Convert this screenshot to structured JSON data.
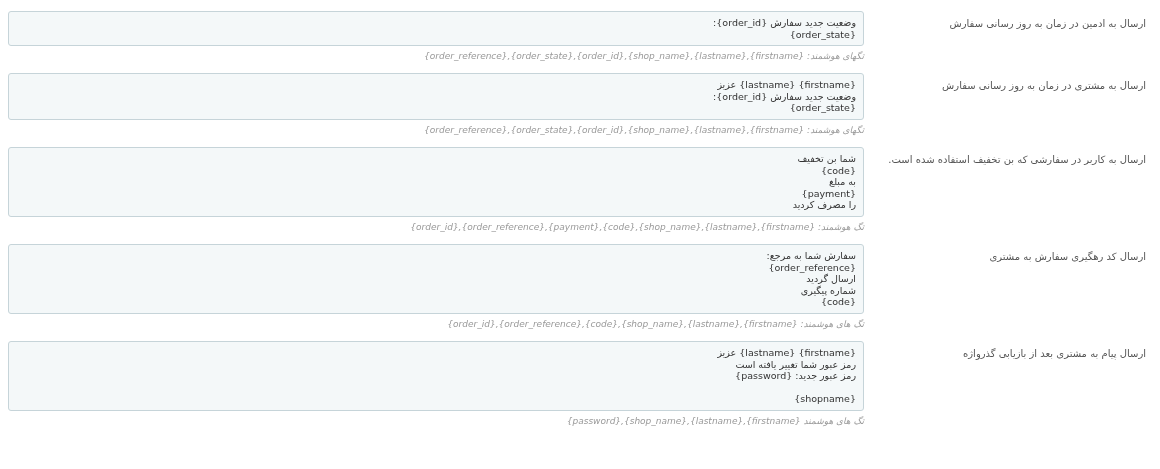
{
  "fields": [
    {
      "label": "ارسال به ادمین در زمان به روز رسانی سفارش",
      "value": "وضعیت جدید سفارش {order_id}:\n{order_state}",
      "hint": "تگهای هوشمند: {firstname},{lastname},{shop_name},{order_id},{order_state},{order_reference}"
    },
    {
      "label": "ارسال به مشتری در زمان به روز رسانی سفارش",
      "value": "{firstname} {lastname} عزیز\nوضعیت جدید سفارش {order_id}:\n{order_state}",
      "hint": "تگهای هوشمند: {firstname},{lastname},{shop_name},{order_id},{order_state},{order_reference}"
    },
    {
      "label": "ارسال به کاربر در سفارشی که بن تخفیف استفاده شده است.",
      "value": "شما بن تخفیف\n{code}\nبه مبلغ\n{payment}\nرا مصرف کردید",
      "hint": "تگ هوشمند: {firstname},{lastname},{shop_name},{code},{payment},{order_reference},{order_id}"
    },
    {
      "label": "ارسال کد رهگیری سفارش به مشتری",
      "value": "سفارش شما به مرجع:\n{order_reference}\nارسال گردید\nشماره پیگیری\n{code}",
      "hint": "تگ های هوشمند: {firstname},{lastname},{shop_name},{code},{order_reference},{order_id}"
    },
    {
      "label": "ارسال پیام به مشتری بعد از بازیابی گذرواژه",
      "value": "{firstname} {lastname} عزیز\nرمز عبور شما تغییر یافته است\nرمز عبور جدید: {password}\n\n{shopname}",
      "hint": "تگ های هوشمند {firstname},{lastname},{shop_name},{password}"
    }
  ]
}
